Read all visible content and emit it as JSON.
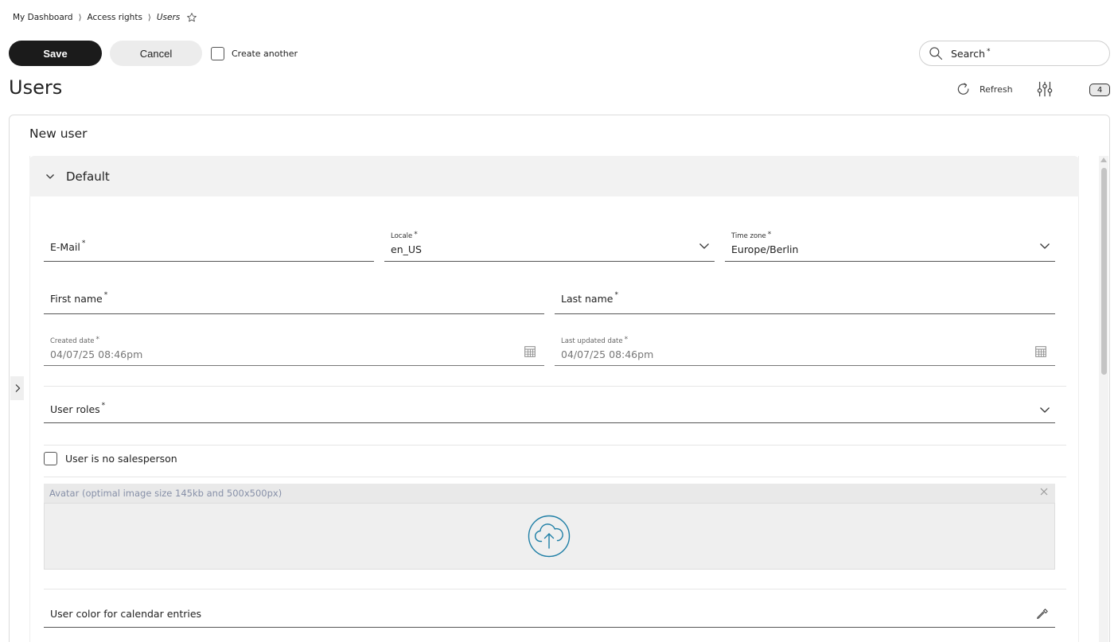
{
  "breadcrumb": {
    "items": [
      "My Dashboard",
      "Access rights",
      "Users"
    ],
    "separator": "⟩",
    "favorite_icon": "star-outline-icon"
  },
  "toolbar": {
    "save_label": "Save",
    "cancel_label": "Cancel",
    "create_another_label": "Create another",
    "create_another_checked": false
  },
  "search": {
    "label": "Search",
    "required_mark": "*",
    "icon": "search-icon"
  },
  "header": {
    "title": "Users",
    "refresh_label": "Refresh",
    "refresh_icon": "refresh-icon",
    "filter_icon": "sliders-icon",
    "count_badge": "4"
  },
  "form": {
    "title": "New user",
    "section_title": "Default",
    "required_mark": "*",
    "fields": {
      "email": {
        "label": "E-Mail"
      },
      "locale": {
        "label": "Locale",
        "value": "en_US"
      },
      "timezone": {
        "label": "Time zone",
        "value": "Europe/Berlin"
      },
      "first_name": {
        "label": "First name"
      },
      "last_name": {
        "label": "Last name"
      },
      "created_date": {
        "label": "Created date",
        "value": "04/07/25 08:46pm"
      },
      "last_updated_date": {
        "label": "Last updated date",
        "value": "04/07/25 08:46pm"
      },
      "user_roles": {
        "label": "User roles"
      },
      "no_salesperson": {
        "label": "User is no salesperson",
        "checked": false
      },
      "avatar": {
        "label": "Avatar (optimal image size 145kb and 500x500px)",
        "upload_icon": "cloud-upload-icon"
      },
      "calendar_color": {
        "label": "User color for calendar entries",
        "icon": "pipette-icon"
      }
    }
  },
  "colors": {
    "save_bg": "#1b1b1b",
    "cancel_bg": "#ececec",
    "section_bg": "#f2f2f2",
    "upload_accent": "#1f7fa6",
    "avatar_label": "#8790a8"
  }
}
